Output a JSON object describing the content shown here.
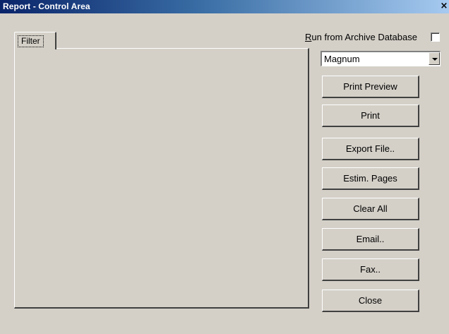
{
  "window": {
    "title": "Report  - Control Area",
    "close_glyph": "×"
  },
  "tabs": [
    {
      "label": "Filter"
    }
  ],
  "archive": {
    "label_mnemonic": "R",
    "label_rest": "un from Archive Database",
    "checked": false
  },
  "combo": {
    "value": "Magnum"
  },
  "buttons": [
    {
      "name": "print-preview-button",
      "pre": "",
      "mn": "P",
      "post": "rint Preview"
    },
    {
      "name": "print-button",
      "pre": "P",
      "mn": "r",
      "post": "int"
    },
    {
      "name": "export-file-button",
      "pre": "",
      "mn": "E",
      "post": "xport File.."
    },
    {
      "name": "estim-pages-button",
      "pre": "",
      "mn": "E",
      "post": "stim. Pages"
    },
    {
      "name": "clear-all-button",
      "pre": "",
      "mn": "C",
      "post": "lear All"
    },
    {
      "name": "email-button",
      "pre": "",
      "mn": "E",
      "post": "mail.."
    },
    {
      "name": "fax-button",
      "pre": "",
      "mn": "F",
      "post": "ax.."
    },
    {
      "name": "close-button",
      "pre": "",
      "mn": "C",
      "post": "lose"
    }
  ]
}
